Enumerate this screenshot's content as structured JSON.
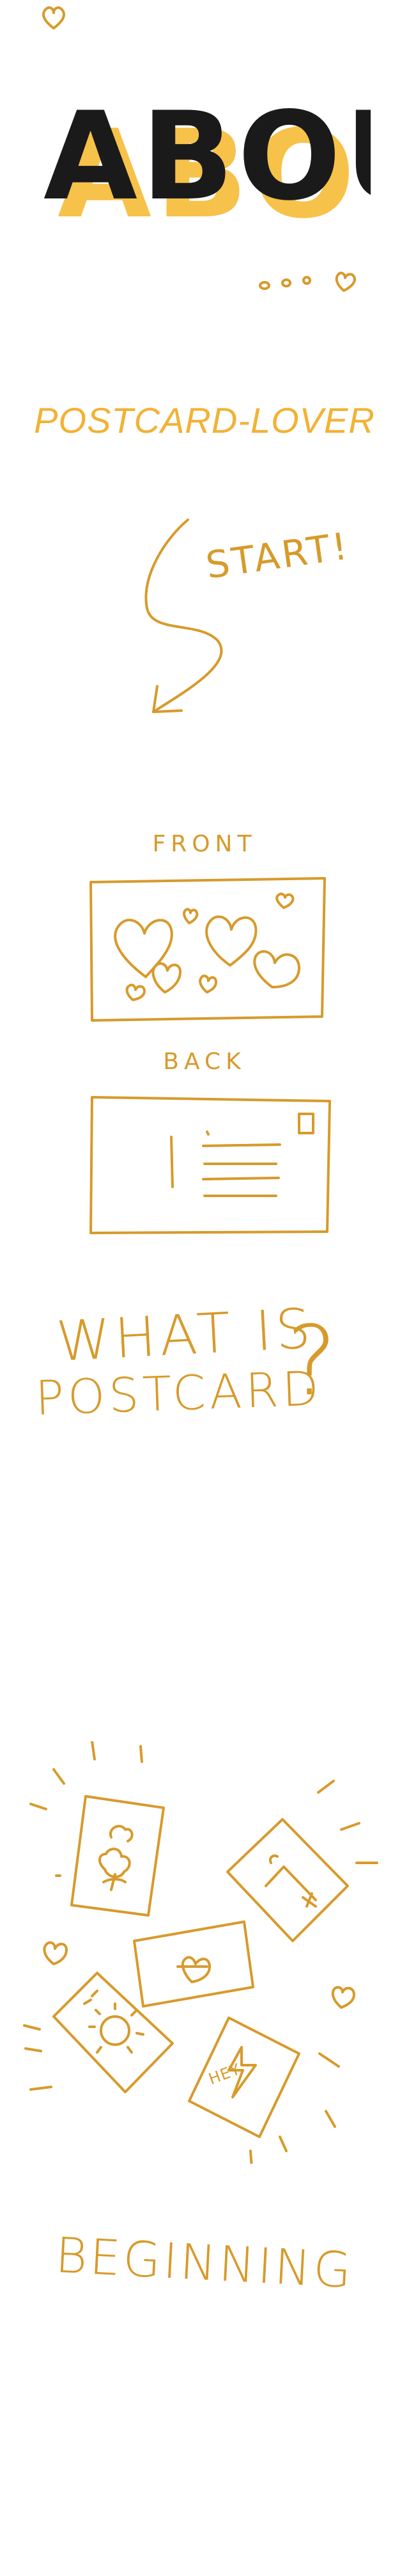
{
  "header": {
    "title": "ABOUT"
  },
  "intro": {
    "subtitle": "POSTCARD-LOVER",
    "start_label": "START!"
  },
  "postcard": {
    "front_label": "FRONT",
    "back_label": "BACK"
  },
  "question": {
    "line1": "WHAT IS",
    "line2": "POSTCARD",
    "mark": "?"
  },
  "beginning": {
    "card_text": "HEY",
    "label": "BEGINNING"
  },
  "colors": {
    "ink": "#d79a2b",
    "title_shadow": "#f7c24a",
    "title_ink": "#1a1a1a",
    "subtitle": "#f2b234"
  }
}
